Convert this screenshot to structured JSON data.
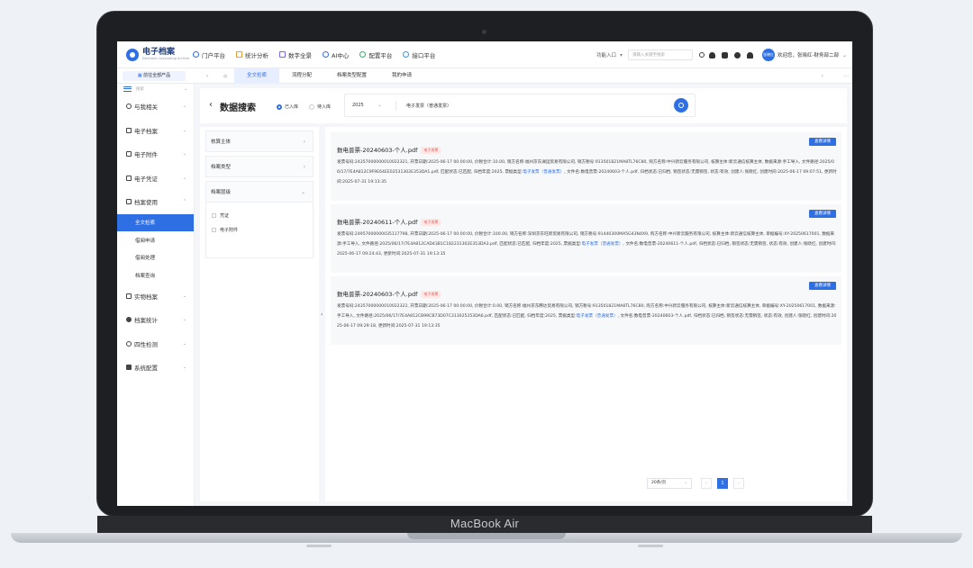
{
  "device": {
    "brand": "MacBook Air"
  },
  "app": {
    "logo_cn": "电子档案",
    "logo_en": "Electronic Accounting Archive"
  },
  "nav": [
    {
      "label": "门户平台",
      "color": "#2f6fe4"
    },
    {
      "label": "统计分析",
      "color": "#f29a2e"
    },
    {
      "label": "数字全景",
      "color": "#7b61ff"
    },
    {
      "label": "AI中心",
      "color": "#2f6fe4"
    },
    {
      "label": "配置平台",
      "color": "#27b36a"
    },
    {
      "label": "接口平台",
      "color": "#2f9be4"
    }
  ],
  "topright": {
    "function_entry": "功能入口",
    "search_placeholder": "请输入关键字搜索",
    "avatar": "张晓红",
    "welcome": "欢迎您，张晓红-财务部二部"
  },
  "tabsbar": {
    "product": "前往全部产品",
    "tabs": [
      "全文检索",
      "流程分配",
      "档案类型配置",
      "我的申请"
    ],
    "active_tab": 0
  },
  "sidebar": {
    "search_placeholder": "搜索",
    "items": [
      {
        "label": "与我相关"
      },
      {
        "label": "电子档案"
      },
      {
        "label": "电子附件"
      },
      {
        "label": "电子凭证"
      },
      {
        "label": "档案使用"
      }
    ],
    "subitems": [
      "全文检索",
      "借阅申请",
      "借阅处理",
      "档案查询"
    ],
    "items_bottom": [
      {
        "label": "实物档案"
      },
      {
        "label": "档案统计"
      },
      {
        "label": "四性检测"
      },
      {
        "label": "系统配置"
      }
    ]
  },
  "header": {
    "title": "数据搜索",
    "radio_in": "已入库",
    "radio_out": "待入库",
    "year": "2025",
    "query": "电子发票（普通发票）"
  },
  "filters": {
    "sections": [
      "核算主体",
      "档案类型",
      "档案层级"
    ],
    "options": [
      "凭证",
      "电子附件"
    ]
  },
  "results": [
    {
      "title": "数电普票-20240603-个人.pdf",
      "badge": "电子发票",
      "detail": "查看详情",
      "body_pre": "发票号码:24357000000010022321, 开票日期:2025-06-17 00:00:00, 价税合计:10.00, 销方名称:福州京东澜运贸易有限公司, 销方税号:913501821MA8TL76C80, 购方名称:中兴新云服务有限公司, 核算主体:新云通信核算主体, 数据来源:手工导入, 文件路径:2025/06/17/7E4A812C9F9E64EE02531302E353DA1.pdf, 匹配状态:已匹配, 归档年度:2025, 票据类型:",
      "body_link": "电子发票（普通发票）",
      "body_post": ", 文件名:数电普票-20240603-个人.pdf, 归档状态:已归档, 销签状态:无需销签, 状态:有效, 创建人:张晓红, 创建时间:2025-06-17 09:07:51, 更新时间:2025-07-31 19:13:35"
    },
    {
      "title": "数电普票-20240611-个人.pdf",
      "badge": "电子发票",
      "detail": "查看详情",
      "body_pre": "发票号码:24957000000035117798, 开票日期:2025-06-17 00:00:00, 价税合计:100.00, 销方名称:深圳京东旺新贸易有限公司, 销方税号:91440300MA5G43N4X9, 购方名称:中兴新云服务有限公司, 核算主体:新云通信核算主体, 单据编号:XY-20250617001, 数据来源:手工导入, 文件路径:2025/06/17/7E4A812CAD43B1C182231302E353DA3.pdf, 匹配状态:已匹配, 归档年度:2025, 票据类型:",
      "body_link": "电子发票（普通发票）",
      "body_post": ", 文件名:数电普票-20240611-个人.pdf, 归档状态:已归档, 销签状态:无需销签, 状态:有效, 创建人:张晓红, 创建时间:2025-06-17 09:24:43, 更新时间:2025-07-31 19:13:35"
    },
    {
      "title": "数电普票-20240603-个人.pdf",
      "badge": "电子发票",
      "detail": "查看详情",
      "body_pre": "发票号码:24357000000010022322, 开票日期:2025-06-17 00:00:00, 价税合计:0.00, 销方名称:福州京东腾达贸易有限公司, 销方税号:913501821MA8TL76C80, 购方名称:中兴新云服务有限公司, 核算主体:新云通信核算主体, 单据编号:XY-20250617001, 数据来源:手工导入, 文件路径:2025/06/17/7E4A812CB99CB73D07C313025353DA6.pdf, 匹配状态:已匹配, 归档年度:2025, 票据类型:",
      "body_link": "电子发票（普通发票）",
      "body_post": ", 文件名:数电普票-20240603-个人.pdf, 归档状态:已归档, 销签状态:无需销签, 状态:有效, 创建人:张晓红, 创建时间:2025-06-17 09:29:18, 更新时间:2025-07-31 19:13:35"
    }
  ],
  "pager": {
    "page_size": "20条/页",
    "current": "1"
  }
}
